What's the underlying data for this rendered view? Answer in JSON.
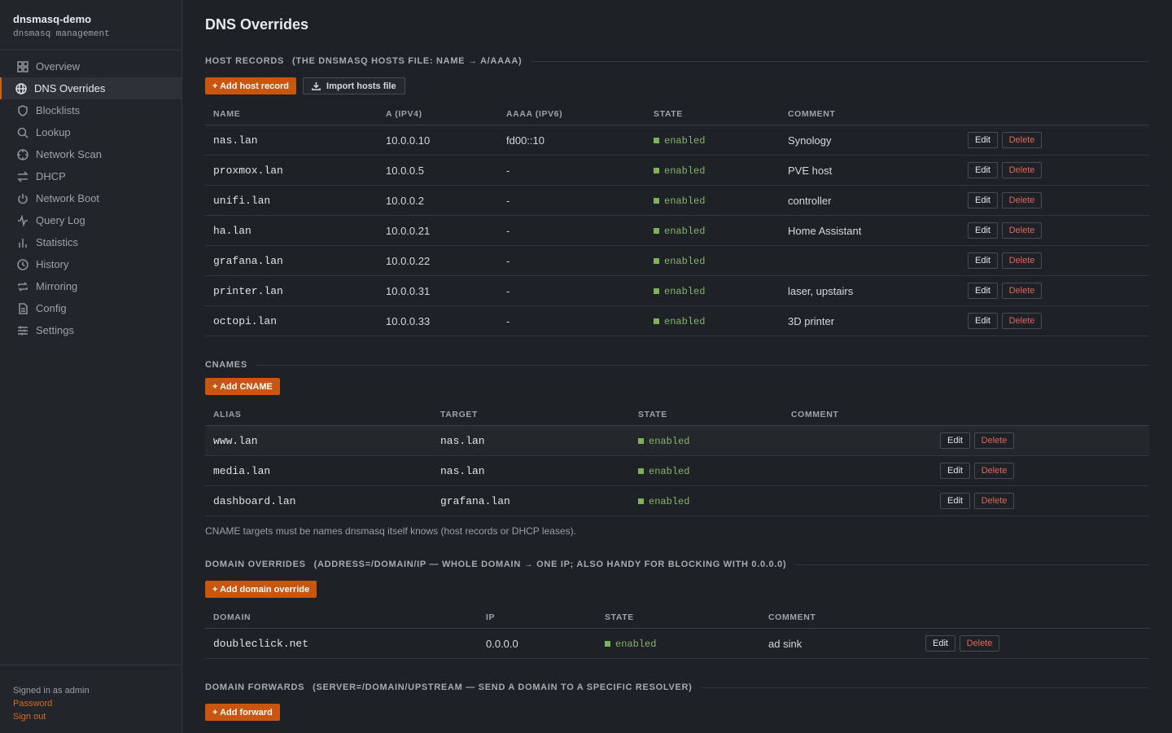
{
  "app": {
    "name": "dnsmasq-demo",
    "subtitle": "dnsmasq management"
  },
  "nav": [
    {
      "label": "Overview",
      "icon": "grid-icon"
    },
    {
      "label": "DNS Overrides",
      "icon": "globe-icon",
      "active": true
    },
    {
      "label": "Blocklists",
      "icon": "shield-icon"
    },
    {
      "label": "Lookup",
      "icon": "search-icon"
    },
    {
      "label": "Network Scan",
      "icon": "radar-icon"
    },
    {
      "label": "DHCP",
      "icon": "arrows-swap-icon"
    },
    {
      "label": "Network Boot",
      "icon": "power-icon"
    },
    {
      "label": "Query Log",
      "icon": "activity-icon"
    },
    {
      "label": "Statistics",
      "icon": "bar-chart-icon"
    },
    {
      "label": "History",
      "icon": "clock-icon"
    },
    {
      "label": "Mirroring",
      "icon": "repeat-icon"
    },
    {
      "label": "Config",
      "icon": "file-icon"
    },
    {
      "label": "Settings",
      "icon": "sliders-icon"
    }
  ],
  "footer": {
    "signed_in": "Signed in as admin",
    "password": "Password",
    "sign_out": "Sign out"
  },
  "page": {
    "title": "DNS Overrides"
  },
  "host_records": {
    "title": "Host records",
    "subtitle": "(the dnsmasq hosts file: name → A/AAAA)",
    "add_label": "+ Add host record",
    "import_label": "Import hosts file",
    "columns": [
      "Name",
      "A (IPv4)",
      "AAAA (IPv6)",
      "State",
      "Comment"
    ],
    "rows": [
      {
        "name": "nas.lan",
        "a": "10.0.0.10",
        "aaaa": "fd00::10",
        "state": "enabled",
        "comment": "Synology"
      },
      {
        "name": "proxmox.lan",
        "a": "10.0.0.5",
        "aaaa": "-",
        "state": "enabled",
        "comment": "PVE host"
      },
      {
        "name": "unifi.lan",
        "a": "10.0.0.2",
        "aaaa": "-",
        "state": "enabled",
        "comment": "controller"
      },
      {
        "name": "ha.lan",
        "a": "10.0.0.21",
        "aaaa": "-",
        "state": "enabled",
        "comment": "Home Assistant"
      },
      {
        "name": "grafana.lan",
        "a": "10.0.0.22",
        "aaaa": "-",
        "state": "enabled",
        "comment": ""
      },
      {
        "name": "printer.lan",
        "a": "10.0.0.31",
        "aaaa": "-",
        "state": "enabled",
        "comment": "laser, upstairs"
      },
      {
        "name": "octopi.lan",
        "a": "10.0.0.33",
        "aaaa": "-",
        "state": "enabled",
        "comment": "3D printer"
      }
    ]
  },
  "cnames": {
    "title": "CNAMEs",
    "add_label": "+ Add CNAME",
    "columns": [
      "Alias",
      "Target",
      "State",
      "Comment"
    ],
    "rows": [
      {
        "alias": "www.lan",
        "target": "nas.lan",
        "state": "enabled",
        "comment": ""
      },
      {
        "alias": "media.lan",
        "target": "nas.lan",
        "state": "enabled",
        "comment": ""
      },
      {
        "alias": "dashboard.lan",
        "target": "grafana.lan",
        "state": "enabled",
        "comment": ""
      }
    ],
    "note": "CNAME targets must be names dnsmasq itself knows (host records or DHCP leases)."
  },
  "domain_overrides": {
    "title": "Domain overrides",
    "subtitle": "(address=/domain/ip — whole domain → one IP; also handy for blocking with 0.0.0.0)",
    "add_label": "+ Add domain override",
    "columns": [
      "Domain",
      "IP",
      "State",
      "Comment"
    ],
    "rows": [
      {
        "domain": "doubleclick.net",
        "ip": "0.0.0.0",
        "state": "enabled",
        "comment": "ad sink"
      }
    ]
  },
  "domain_forwards": {
    "title": "Domain forwards",
    "subtitle": "(server=/domain/upstream — send a domain to a specific resolver)",
    "add_label": "+ Add forward"
  },
  "actions": {
    "edit": "Edit",
    "delete": "Delete"
  },
  "colors": {
    "accent": "#c9560f",
    "enabled": "#7fb05c",
    "danger": "#e0665b"
  }
}
